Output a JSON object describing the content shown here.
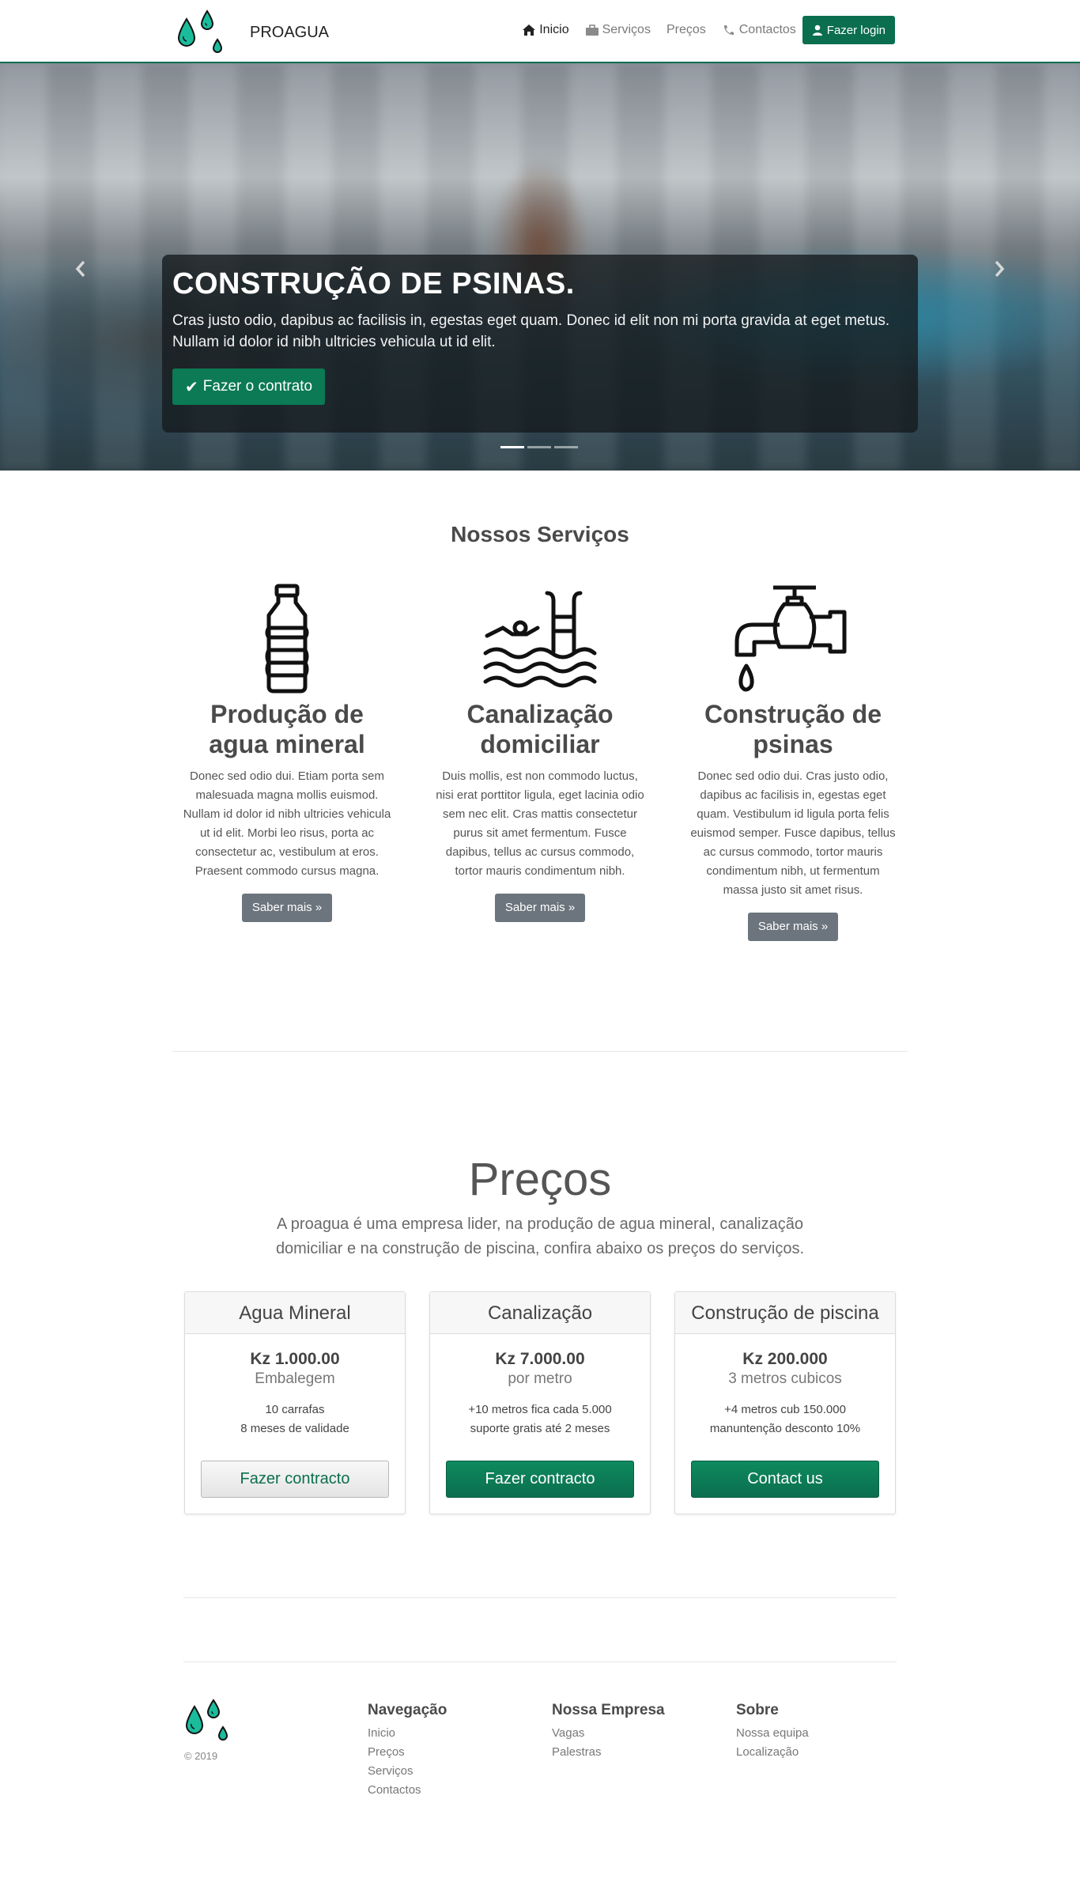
{
  "navbar": {
    "brand": "PROAGUA",
    "items": [
      {
        "label": "Inicio",
        "icon": "home-icon"
      },
      {
        "label": "Serviços",
        "icon": "briefcase-icon"
      },
      {
        "label": "Preços",
        "icon": ""
      },
      {
        "label": "Contactos",
        "icon": "phone-icon"
      }
    ],
    "login_label": "Fazer login"
  },
  "hero": {
    "title": "CONSTRUÇÃO DE PSINAS.",
    "text": "Cras justo odio, dapibus ac facilisis in, egestas eget quam. Donec id elit non mi porta gravida at eget metus. Nullam id dolor id nibh ultricies vehicula ut id elit.",
    "button_label": "Fazer o contrato",
    "prev_icon": "chevron-left-icon",
    "next_icon": "chevron-right-icon",
    "slides_count": 3,
    "active_slide": 1
  },
  "services": {
    "title": "Nossos Serviços",
    "items": [
      {
        "icon": "water-bottle-icon",
        "title": "Produção de agua mineral",
        "text": "Donec sed odio dui. Etiam porta sem malesuada magna mollis euismod. Nullam id dolor id nibh ultricies vehicula ut id elit. Morbi leo risus, porta ac consectetur ac, vestibulum at eros. Praesent commodo cursus magna.",
        "button_label": "Saber mais »"
      },
      {
        "icon": "swimming-pool-icon",
        "title": "Canalização domiciliar",
        "text": "Duis mollis, est non commodo luctus, nisi erat porttitor ligula, eget lacinia odio sem nec elit. Cras mattis consectetur purus sit amet fermentum. Fusce dapibus, tellus ac cursus commodo, tortor mauris condimentum nibh.",
        "button_label": "Saber mais »"
      },
      {
        "icon": "water-tap-icon",
        "title": "Construção de psinas",
        "text": "Donec sed odio dui. Cras justo odio, dapibus ac facilisis in, egestas eget quam. Vestibulum id ligula porta felis euismod semper. Fusce dapibus, tellus ac cursus commodo, tortor mauris condimentum nibh, ut fermentum massa justo sit amet risus.",
        "button_label": "Saber mais »"
      }
    ]
  },
  "prices": {
    "title": "Preços",
    "lead": "A proagua é uma empresa lider, na produção de agua mineral, canalização domiciliar e na construção de piscina, confira abaixo os preços do serviços.",
    "cards": [
      {
        "title": "Agua Mineral",
        "price": "Kz 1.000.00",
        "unit": "Embalegem",
        "lines": [
          "10 carrafas",
          "8 meses de validade"
        ],
        "button_label": "Fazer contracto",
        "button_style": "outline"
      },
      {
        "title": "Canalização",
        "price": "Kz 7.000.00",
        "unit": "por metro",
        "lines": [
          "+10 metros fica cada 5.000",
          "suporte gratis até 2 meses"
        ],
        "button_label": "Fazer contracto",
        "button_style": "solid"
      },
      {
        "title": "Construção de piscina",
        "price": "Kz 200.000",
        "unit": "3 metros cubicos",
        "lines": [
          "+4 metros cub 150.000",
          "manuntenção desconto 10%"
        ],
        "button_label": "Contact us",
        "button_style": "solid"
      }
    ]
  },
  "footer": {
    "copyright": "© 2019",
    "columns": [
      {
        "title": "Navegação",
        "links": [
          "Inicio",
          "Preços",
          "Serviços",
          "Contactos"
        ]
      },
      {
        "title": "Nossa Empresa",
        "links": [
          "Vagas",
          "Palestras"
        ]
      },
      {
        "title": "Sobre",
        "links": [
          "Nossa equipa",
          "Localização"
        ]
      }
    ]
  },
  "colors": {
    "brand_green": "#0b6e4f",
    "drop_teal": "#1abc9c",
    "secondary_button": "#6c757d"
  }
}
